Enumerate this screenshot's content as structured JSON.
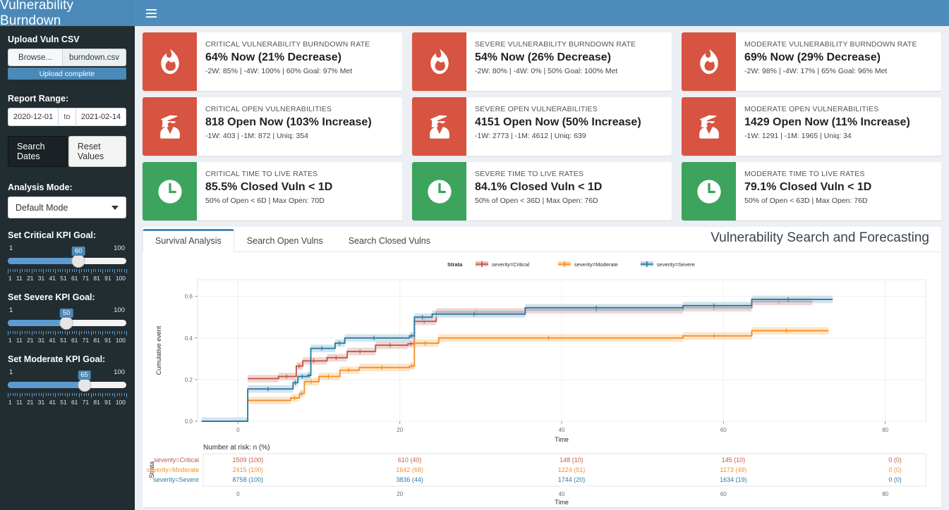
{
  "header": {
    "brand": "Vulnerability Burndown",
    "menu_icon": "hamburger-icon"
  },
  "sidebar": {
    "upload": {
      "label": "Upload Vuln CSV",
      "browse_label": "Browse...",
      "file_name": "burndown.csv",
      "progress_label": "Upload complete"
    },
    "report_range": {
      "label": "Report Range:",
      "start_date": "2020-12-01",
      "separator": "to",
      "end_date": "2021-02-14",
      "search_label": "Search Dates",
      "reset_label": "Reset Values"
    },
    "analysis_mode": {
      "label": "Analysis Mode:",
      "selected": "Default Mode",
      "caret_icon": "chevron-down-icon"
    },
    "sliders": [
      {
        "label": "Set Critical KPI Goal:",
        "min": "1",
        "max": "100",
        "value": 60,
        "value_text": "60",
        "ticks": [
          "1",
          "11",
          "21",
          "31",
          "41",
          "51",
          "61",
          "71",
          "81",
          "91",
          "100"
        ]
      },
      {
        "label": "Set Severe KPI Goal:",
        "min": "1",
        "max": "100",
        "value": 50,
        "value_text": "50",
        "ticks": [
          "1",
          "11",
          "21",
          "31",
          "41",
          "51",
          "61",
          "71",
          "81",
          "91",
          "100"
        ]
      },
      {
        "label": "Set Moderate KPI Goal:",
        "min": "1",
        "max": "100",
        "value": 65,
        "value_text": "65",
        "ticks": [
          "1",
          "11",
          "21",
          "31",
          "41",
          "51",
          "61",
          "71",
          "81",
          "91",
          "100"
        ]
      }
    ]
  },
  "cards": [
    {
      "icon": "fire-icon",
      "color": "#d75442",
      "title": "CRITICAL VULNERABILITY BURNDOWN RATE",
      "value": "64% Now (21% Decrease)",
      "sub": "-2W: 85% | -4W: 100% | 60% Goal: 97% Met"
    },
    {
      "icon": "fire-icon",
      "color": "#d75442",
      "title": "SEVERE VULNERABILITY BURNDOWN RATE",
      "value": "54% Now (26% Decrease)",
      "sub": "-2W: 80% | -4W: 0% | 50% Goal: 100% Met"
    },
    {
      "icon": "fire-icon",
      "color": "#d75442",
      "title": "MODERATE VULNERABILITY BURNDOWN RATE",
      "value": "69% Now (29% Decrease)",
      "sub": "-2W: 98% | -4W: 17% | 65% Goal: 96% Met"
    },
    {
      "icon": "user-secret-icon",
      "color": "#d75442",
      "title": "CRITICAL OPEN VULNERABILITIES",
      "value": "818 Open Now (103% Increase)",
      "sub": "-1W: 403 | -1M: 872 | Uniq: 354"
    },
    {
      "icon": "user-secret-icon",
      "color": "#d75442",
      "title": "SEVERE OPEN VULNERABILITIES",
      "value": "4151 Open Now (50% Increase)",
      "sub": "-1W: 2773 | -1M: 4612 | Uniq: 639"
    },
    {
      "icon": "user-secret-icon",
      "color": "#d75442",
      "title": "MODERATE OPEN VULNERABILITIES",
      "value": "1429 Open Now (11% Increase)",
      "sub": "-1W: 1291 | -1M: 1965 | Uniq: 34"
    },
    {
      "icon": "clock-icon",
      "color": "#3da45d",
      "title": "CRITICAL TIME TO LIVE RATES",
      "value": "85.5% Closed Vuln < 1D",
      "sub": "50% of Open < 6D | Max Open: 70D"
    },
    {
      "icon": "clock-icon",
      "color": "#3da45d",
      "title": "SEVERE TIME TO LIVE RATES",
      "value": "84.1% Closed Vuln < 1D",
      "sub": "50% of Open < 36D | Max Open: 76D"
    },
    {
      "icon": "clock-icon",
      "color": "#3da45d",
      "title": "MODERATE TIME TO LIVE RATES",
      "value": "79.1% Closed Vuln < 1D",
      "sub": "50% of Open < 63D | Max Open: 76D"
    }
  ],
  "panel": {
    "title": "Vulnerability Search and Forecasting",
    "tabs": [
      {
        "label": "Survival Analysis",
        "active": true
      },
      {
        "label": "Search Open Vulns",
        "active": false
      },
      {
        "label": "Search Closed Vulns",
        "active": false
      }
    ]
  },
  "chart_data": {
    "type": "line",
    "title": "",
    "xlabel": "Time",
    "ylabel": "Cumulative event",
    "xlim": [
      -5,
      85
    ],
    "ylim": [
      0.0,
      0.68
    ],
    "xticks": [
      0,
      20,
      40,
      60,
      80
    ],
    "yticks": [
      "0.0",
      "0.2",
      "0.4",
      "0.6"
    ],
    "grid": true,
    "legend_title": "Strata",
    "legend_position": "top",
    "series": [
      {
        "name": "severity=Critical",
        "color": "#c4584a",
        "band_color": "#e8c2bc",
        "steps": [
          [
            1.2,
            0.205
          ],
          [
            5.0,
            0.215
          ],
          [
            7.2,
            0.265
          ],
          [
            8.0,
            0.29
          ],
          [
            11.0,
            0.305
          ],
          [
            13.5,
            0.335
          ],
          [
            17.0,
            0.365
          ],
          [
            21.0,
            0.372
          ],
          [
            21.8,
            0.48
          ],
          [
            24.5,
            0.525
          ],
          [
            35.5,
            0.535
          ],
          [
            55.0,
            0.545
          ],
          [
            63.5,
            0.575
          ],
          [
            71.0,
            0.575
          ]
        ]
      },
      {
        "name": "severity=Moderate",
        "color": "#f5902a",
        "band_color": "#fbd9ac",
        "steps": [
          [
            1.2,
            0.1
          ],
          [
            6.5,
            0.112
          ],
          [
            7.6,
            0.133
          ],
          [
            8.2,
            0.19
          ],
          [
            10.0,
            0.215
          ],
          [
            12.6,
            0.245
          ],
          [
            15.0,
            0.258
          ],
          [
            21.2,
            0.265
          ],
          [
            21.8,
            0.375
          ],
          [
            24.8,
            0.4
          ],
          [
            55.0,
            0.41
          ],
          [
            63.5,
            0.435
          ],
          [
            73.0,
            0.435
          ]
        ]
      },
      {
        "name": "severity=Severe",
        "color": "#2b7ca2",
        "band_color": "#bcd6e3",
        "steps": [
          [
            -4.5,
            0.0
          ],
          [
            1.2,
            0.155
          ],
          [
            6.8,
            0.185
          ],
          [
            7.4,
            0.215
          ],
          [
            8.6,
            0.22
          ],
          [
            9.0,
            0.35
          ],
          [
            12.0,
            0.375
          ],
          [
            13.2,
            0.4
          ],
          [
            21.2,
            0.41
          ],
          [
            21.8,
            0.5
          ],
          [
            24.0,
            0.515
          ],
          [
            35.5,
            0.545
          ],
          [
            55.0,
            0.555
          ],
          [
            63.5,
            0.585
          ],
          [
            73.5,
            0.585
          ]
        ]
      }
    ],
    "risk_table": {
      "caption": "Number at risk: n (%)",
      "row_axis_label": "Strata",
      "xlabel": "Time",
      "columns": [
        0,
        20,
        40,
        60,
        80
      ],
      "rows": [
        {
          "label": "severity=Critical",
          "color": "#c4584a",
          "values": [
            "1509 (100)",
            "610 (40)",
            "148 (10)",
            "145 (10)",
            "0 (0)"
          ]
        },
        {
          "label": "severity=Moderate",
          "color": "#f5902a",
          "values": [
            "2415 (100)",
            "1642 (68)",
            "1224 (51)",
            "1173 (49)",
            "0 (0)"
          ]
        },
        {
          "label": "severity=Severe",
          "color": "#2b7ca2",
          "values": [
            "8758 (100)",
            "3836 (44)",
            "1744 (20)",
            "1634 (19)",
            "0 (0)"
          ]
        }
      ]
    }
  }
}
